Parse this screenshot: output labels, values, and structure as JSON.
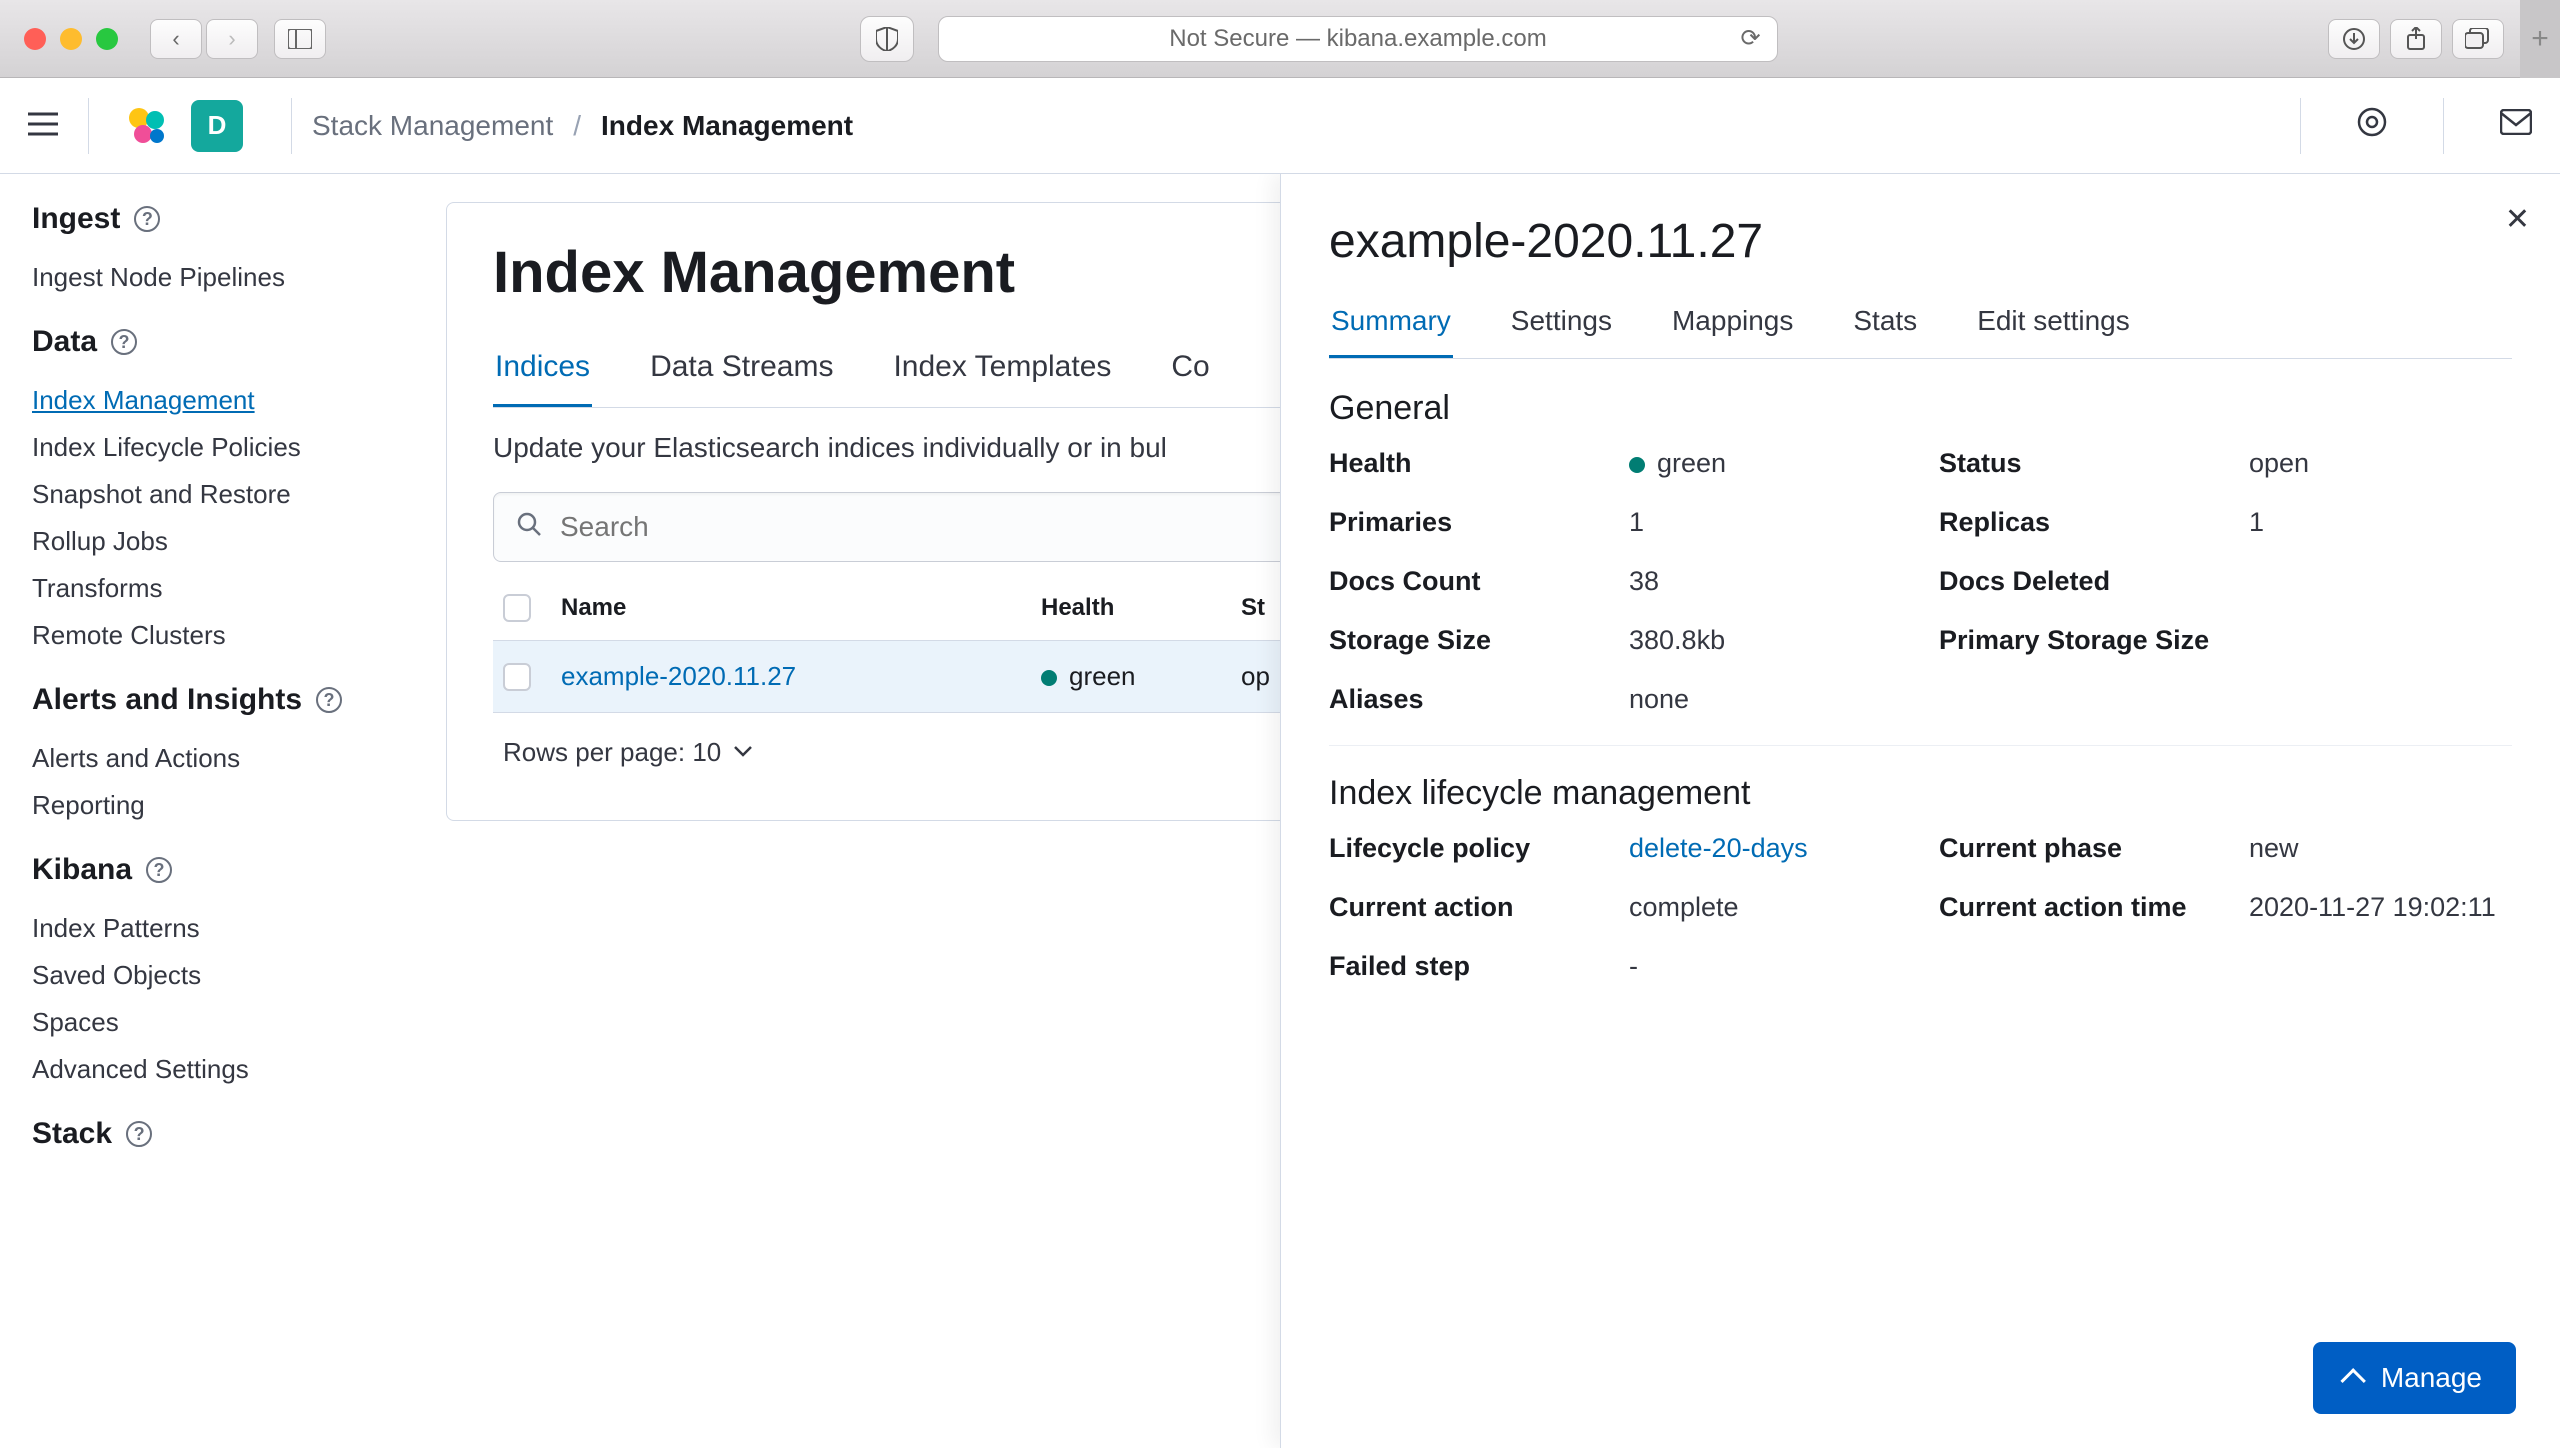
{
  "browser": {
    "url_label": "Not Secure — kibana.example.com"
  },
  "header": {
    "space_initial": "D",
    "breadcrumb1": "Stack Management",
    "breadcrumb2": "Index Management"
  },
  "sidebar": {
    "groups": [
      {
        "title": "Ingest",
        "items": [
          "Ingest Node Pipelines"
        ]
      },
      {
        "title": "Data",
        "items": [
          "Index Management",
          "Index Lifecycle Policies",
          "Snapshot and Restore",
          "Rollup Jobs",
          "Transforms",
          "Remote Clusters"
        ],
        "active_index": 0
      },
      {
        "title": "Alerts and Insights",
        "items": [
          "Alerts and Actions",
          "Reporting"
        ]
      },
      {
        "title": "Kibana",
        "items": [
          "Index Patterns",
          "Saved Objects",
          "Spaces",
          "Advanced Settings"
        ]
      },
      {
        "title": "Stack",
        "items": []
      }
    ]
  },
  "main": {
    "title": "Index Management",
    "tabs": [
      "Indices",
      "Data Streams",
      "Index Templates",
      "Co"
    ],
    "active_tab": 0,
    "description": "Update your Elasticsearch indices individually or in bul",
    "search_placeholder": "Search",
    "columns": {
      "name": "Name",
      "health": "Health",
      "status": "St"
    },
    "rows": [
      {
        "name": "example-2020.11.27",
        "health": "green",
        "status": "op"
      }
    ],
    "pager": "Rows per page: 10"
  },
  "flyout": {
    "title": "example-2020.11.27",
    "tabs": [
      "Summary",
      "Settings",
      "Mappings",
      "Stats",
      "Edit settings"
    ],
    "active_tab": 0,
    "section_general": "General",
    "general": {
      "health_k": "Health",
      "health_v": "green",
      "status_k": "Status",
      "status_v": "open",
      "primaries_k": "Primaries",
      "primaries_v": "1",
      "replicas_k": "Replicas",
      "replicas_v": "1",
      "docs_count_k": "Docs Count",
      "docs_count_v": "38",
      "docs_deleted_k": "Docs Deleted",
      "docs_deleted_v": "",
      "storage_k": "Storage Size",
      "storage_v": "380.8kb",
      "primary_storage_k": "Primary Storage Size",
      "primary_storage_v": "",
      "aliases_k": "Aliases",
      "aliases_v": "none"
    },
    "section_ilm": "Index lifecycle management",
    "ilm": {
      "policy_k": "Lifecycle policy",
      "policy_v": "delete-20-days",
      "phase_k": "Current phase",
      "phase_v": "new",
      "action_k": "Current action",
      "action_v": "complete",
      "action_time_k": "Current action time",
      "action_time_v": "2020-11-27 19:02:11",
      "failed_k": "Failed step",
      "failed_v": "-"
    },
    "manage_label": "Manage"
  }
}
